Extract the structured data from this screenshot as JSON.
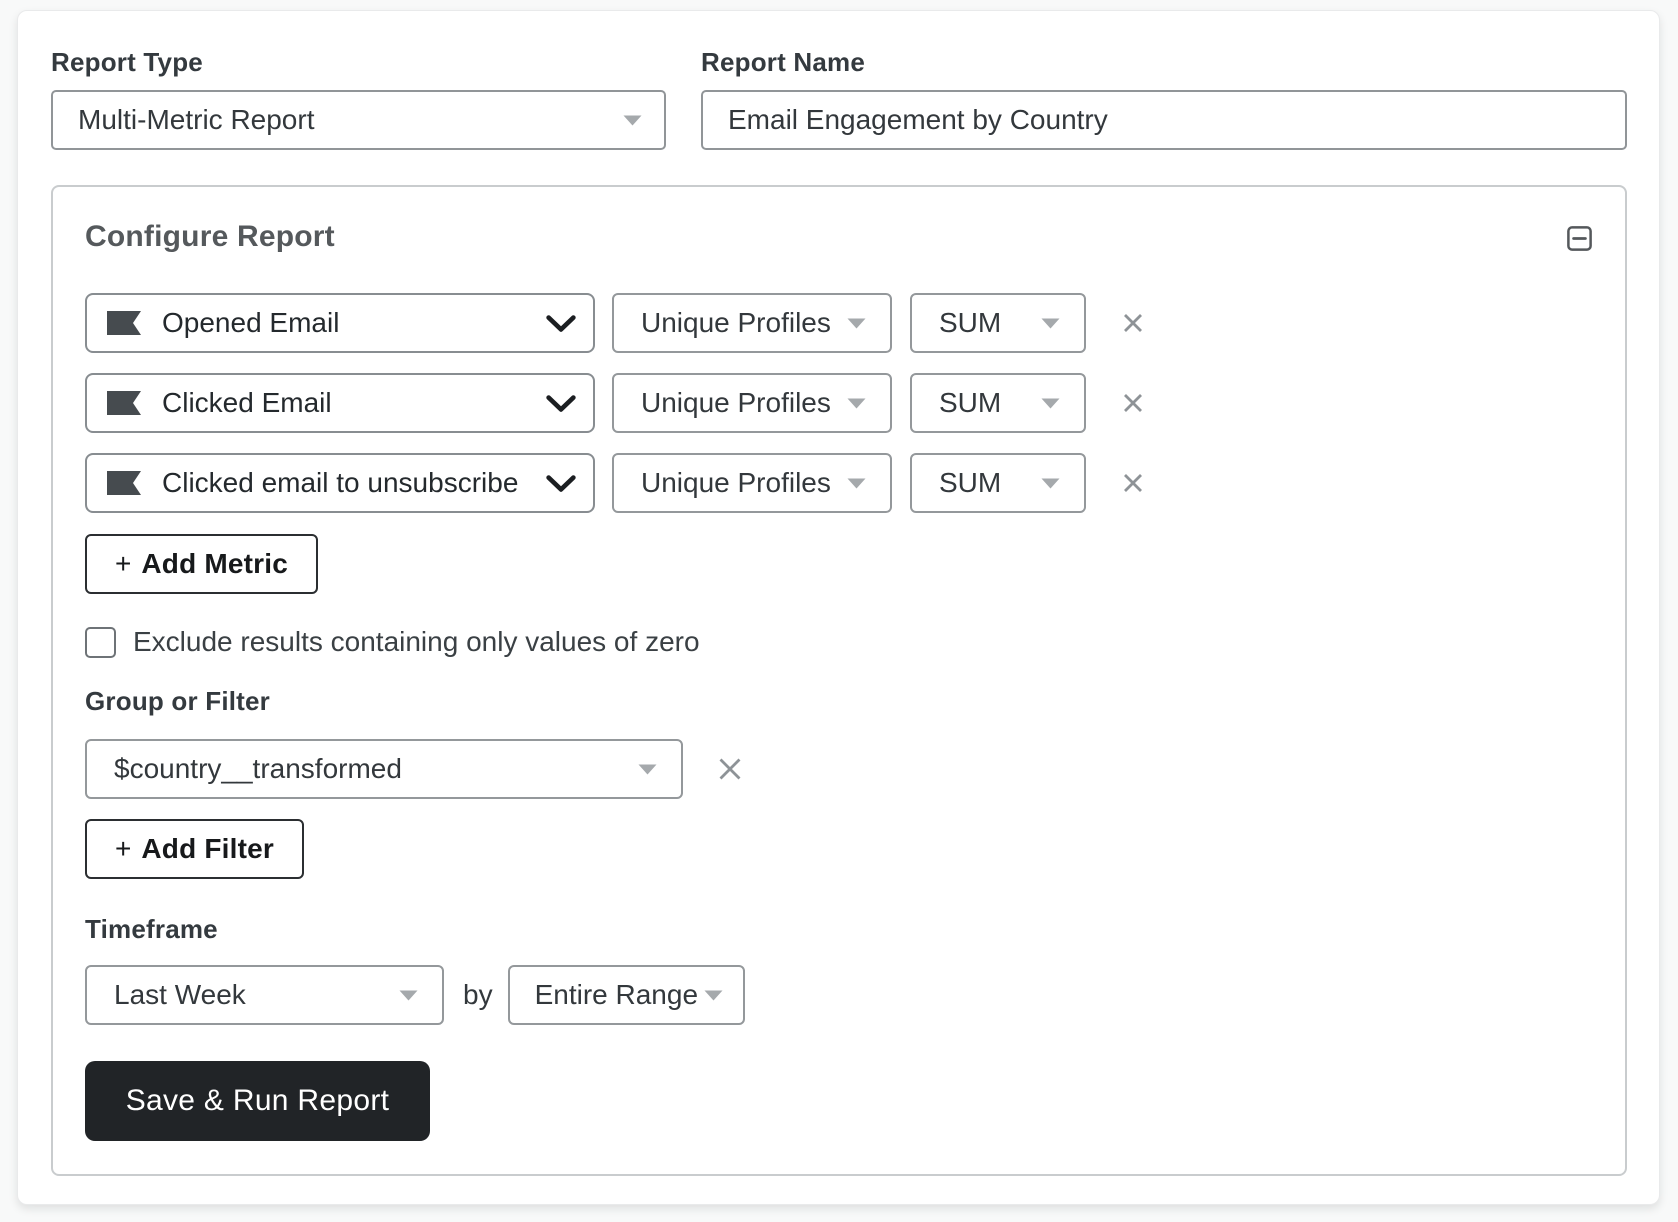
{
  "report_type": {
    "label": "Report Type",
    "value": "Multi-Metric Report"
  },
  "report_name": {
    "label": "Report Name",
    "value": "Email Engagement by Country"
  },
  "configure_panel": {
    "title": "Configure Report",
    "collapse_icon": "minus-square"
  },
  "metrics": {
    "rows": [
      {
        "metric": "Opened Email",
        "measurement": "Unique Profiles",
        "aggregation": "SUM"
      },
      {
        "metric": "Clicked Email",
        "measurement": "Unique Profiles",
        "aggregation": "SUM"
      },
      {
        "metric": "Clicked email to unsubscribe",
        "measurement": "Unique Profiles",
        "aggregation": "SUM"
      }
    ],
    "add_button": {
      "plus": "+",
      "label": "Add Metric"
    },
    "exclude_zero": {
      "checked": false,
      "label": "Exclude results containing only values of zero"
    }
  },
  "group_or_filter": {
    "label": "Group or Filter",
    "value": "$country__transformed",
    "add_button": {
      "plus": "+",
      "label": "Add Filter"
    }
  },
  "timeframe": {
    "label": "Timeframe",
    "value": "Last Week",
    "by": "by",
    "breakdown": "Entire Range"
  },
  "actions": {
    "save_run": "Save & Run Report"
  },
  "colors": {
    "accent_dark": "#212427",
    "control_border": "#919598",
    "panel_border": "#c9ccce",
    "flag_icon": "#464b4f",
    "muted_caret": "#a5a9ac",
    "remove_icon": "#8e9397"
  }
}
